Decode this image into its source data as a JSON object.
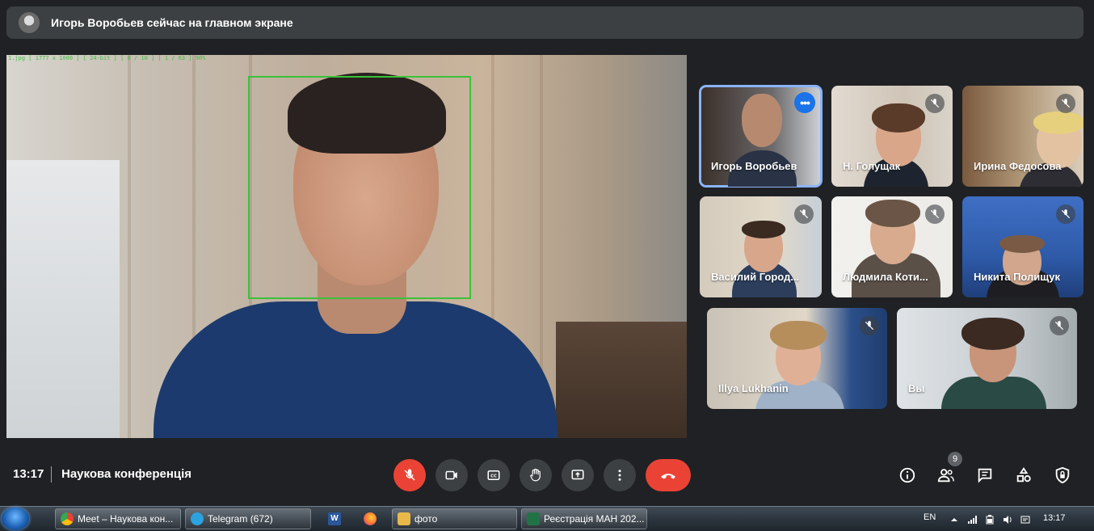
{
  "banner": {
    "text": "Игорь Воробьев сейчас на главном экране"
  },
  "main_video": {
    "overlay_text": "1.jpg [ 1777 x 1000 ] [ 24-bit ] [ 0 / 10 ] [ 1 / 63 ] 90%"
  },
  "participants": [
    {
      "name": "Игорь Воробьев",
      "muted": false,
      "active": true
    },
    {
      "name": "Н. Голущак",
      "muted": true
    },
    {
      "name": "Ирина Федосова",
      "muted": true
    },
    {
      "name": "Василий Городецкий",
      "display": "Василий Город...",
      "muted": true
    },
    {
      "name": "Людмила Котилевская",
      "display": "Людмила Коти...",
      "muted": true
    },
    {
      "name": "Никита Полищук",
      "muted": true
    },
    {
      "name": "Illya Lukhanin",
      "muted": true
    },
    {
      "name": "Вы",
      "muted": true
    }
  ],
  "bottom_bar": {
    "time": "13:17",
    "meeting_title": "Наукова конференція",
    "people_count": "9"
  },
  "taskbar": {
    "items": [
      {
        "label": "Meet – Наукова кон..."
      },
      {
        "label": "Telegram (672)"
      },
      {
        "label": "фото"
      },
      {
        "label": "Реєстрація МАН 202..."
      }
    ],
    "language": "EN",
    "clock": "13:17"
  },
  "colors": {
    "background": "#202124",
    "accent_blue": "#8ab4f8",
    "end_call_red": "#ea4335",
    "face_box_green": "#39c239"
  }
}
